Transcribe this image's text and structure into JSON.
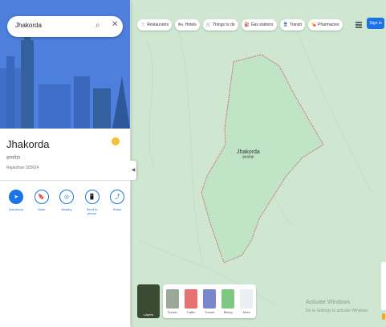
{
  "search": {
    "value": "Jhakorda"
  },
  "map": {
    "chips": [
      {
        "icon": "fork-knife-icon",
        "glyph": "🍴",
        "label": "Restaurants"
      },
      {
        "icon": "bed-icon",
        "glyph": "🛏",
        "label": "Hotels"
      },
      {
        "icon": "cart-icon",
        "glyph": "🛒",
        "label": "Things to do"
      },
      {
        "icon": "gas-icon",
        "glyph": "⛽",
        "label": "Gas stations"
      },
      {
        "icon": "transit-icon",
        "glyph": "🚆",
        "label": "Transit"
      },
      {
        "icon": "pharmacy-icon",
        "glyph": "💊",
        "label": "Pharmacies"
      }
    ],
    "signin_label": "Sign in",
    "area_label": "Jhakorda",
    "area_sublabel": "झाकोड़ा",
    "top_label": "",
    "left_label": "",
    "left_sublabel": "",
    "right_label": "",
    "right_sublabel": "",
    "layers_label": "Layers",
    "layer_items": [
      {
        "label": "Terrain",
        "color": "#9aa89a"
      },
      {
        "label": "Traffic",
        "color": "#e57373"
      },
      {
        "label": "Transit",
        "color": "#7986cb"
      },
      {
        "label": "Biking",
        "color": "#81c784"
      },
      {
        "label": "More",
        "color": "#eceff1"
      }
    ],
    "watermark_line1": "Activate Windows",
    "watermark_line2": "Go to Settings to activate Windows."
  },
  "place": {
    "title": "Jhakorda",
    "local_name": "झाकोड़ा",
    "region": "Rajasthan 305624",
    "weather_line1": "",
    "weather_line2": ""
  },
  "actions": [
    {
      "label": "Directions",
      "icon": "directions-icon",
      "glyph": "➤",
      "filled": true
    },
    {
      "label": "Save",
      "icon": "bookmark-icon",
      "glyph": "🔖",
      "filled": false
    },
    {
      "label": "Nearby",
      "icon": "nearby-icon",
      "glyph": "◎",
      "filled": false
    },
    {
      "label": "Send to phone",
      "icon": "phone-icon",
      "glyph": "📱",
      "filled": false
    },
    {
      "label": "Share",
      "icon": "share-icon",
      "glyph": "⤴",
      "filled": false
    }
  ]
}
